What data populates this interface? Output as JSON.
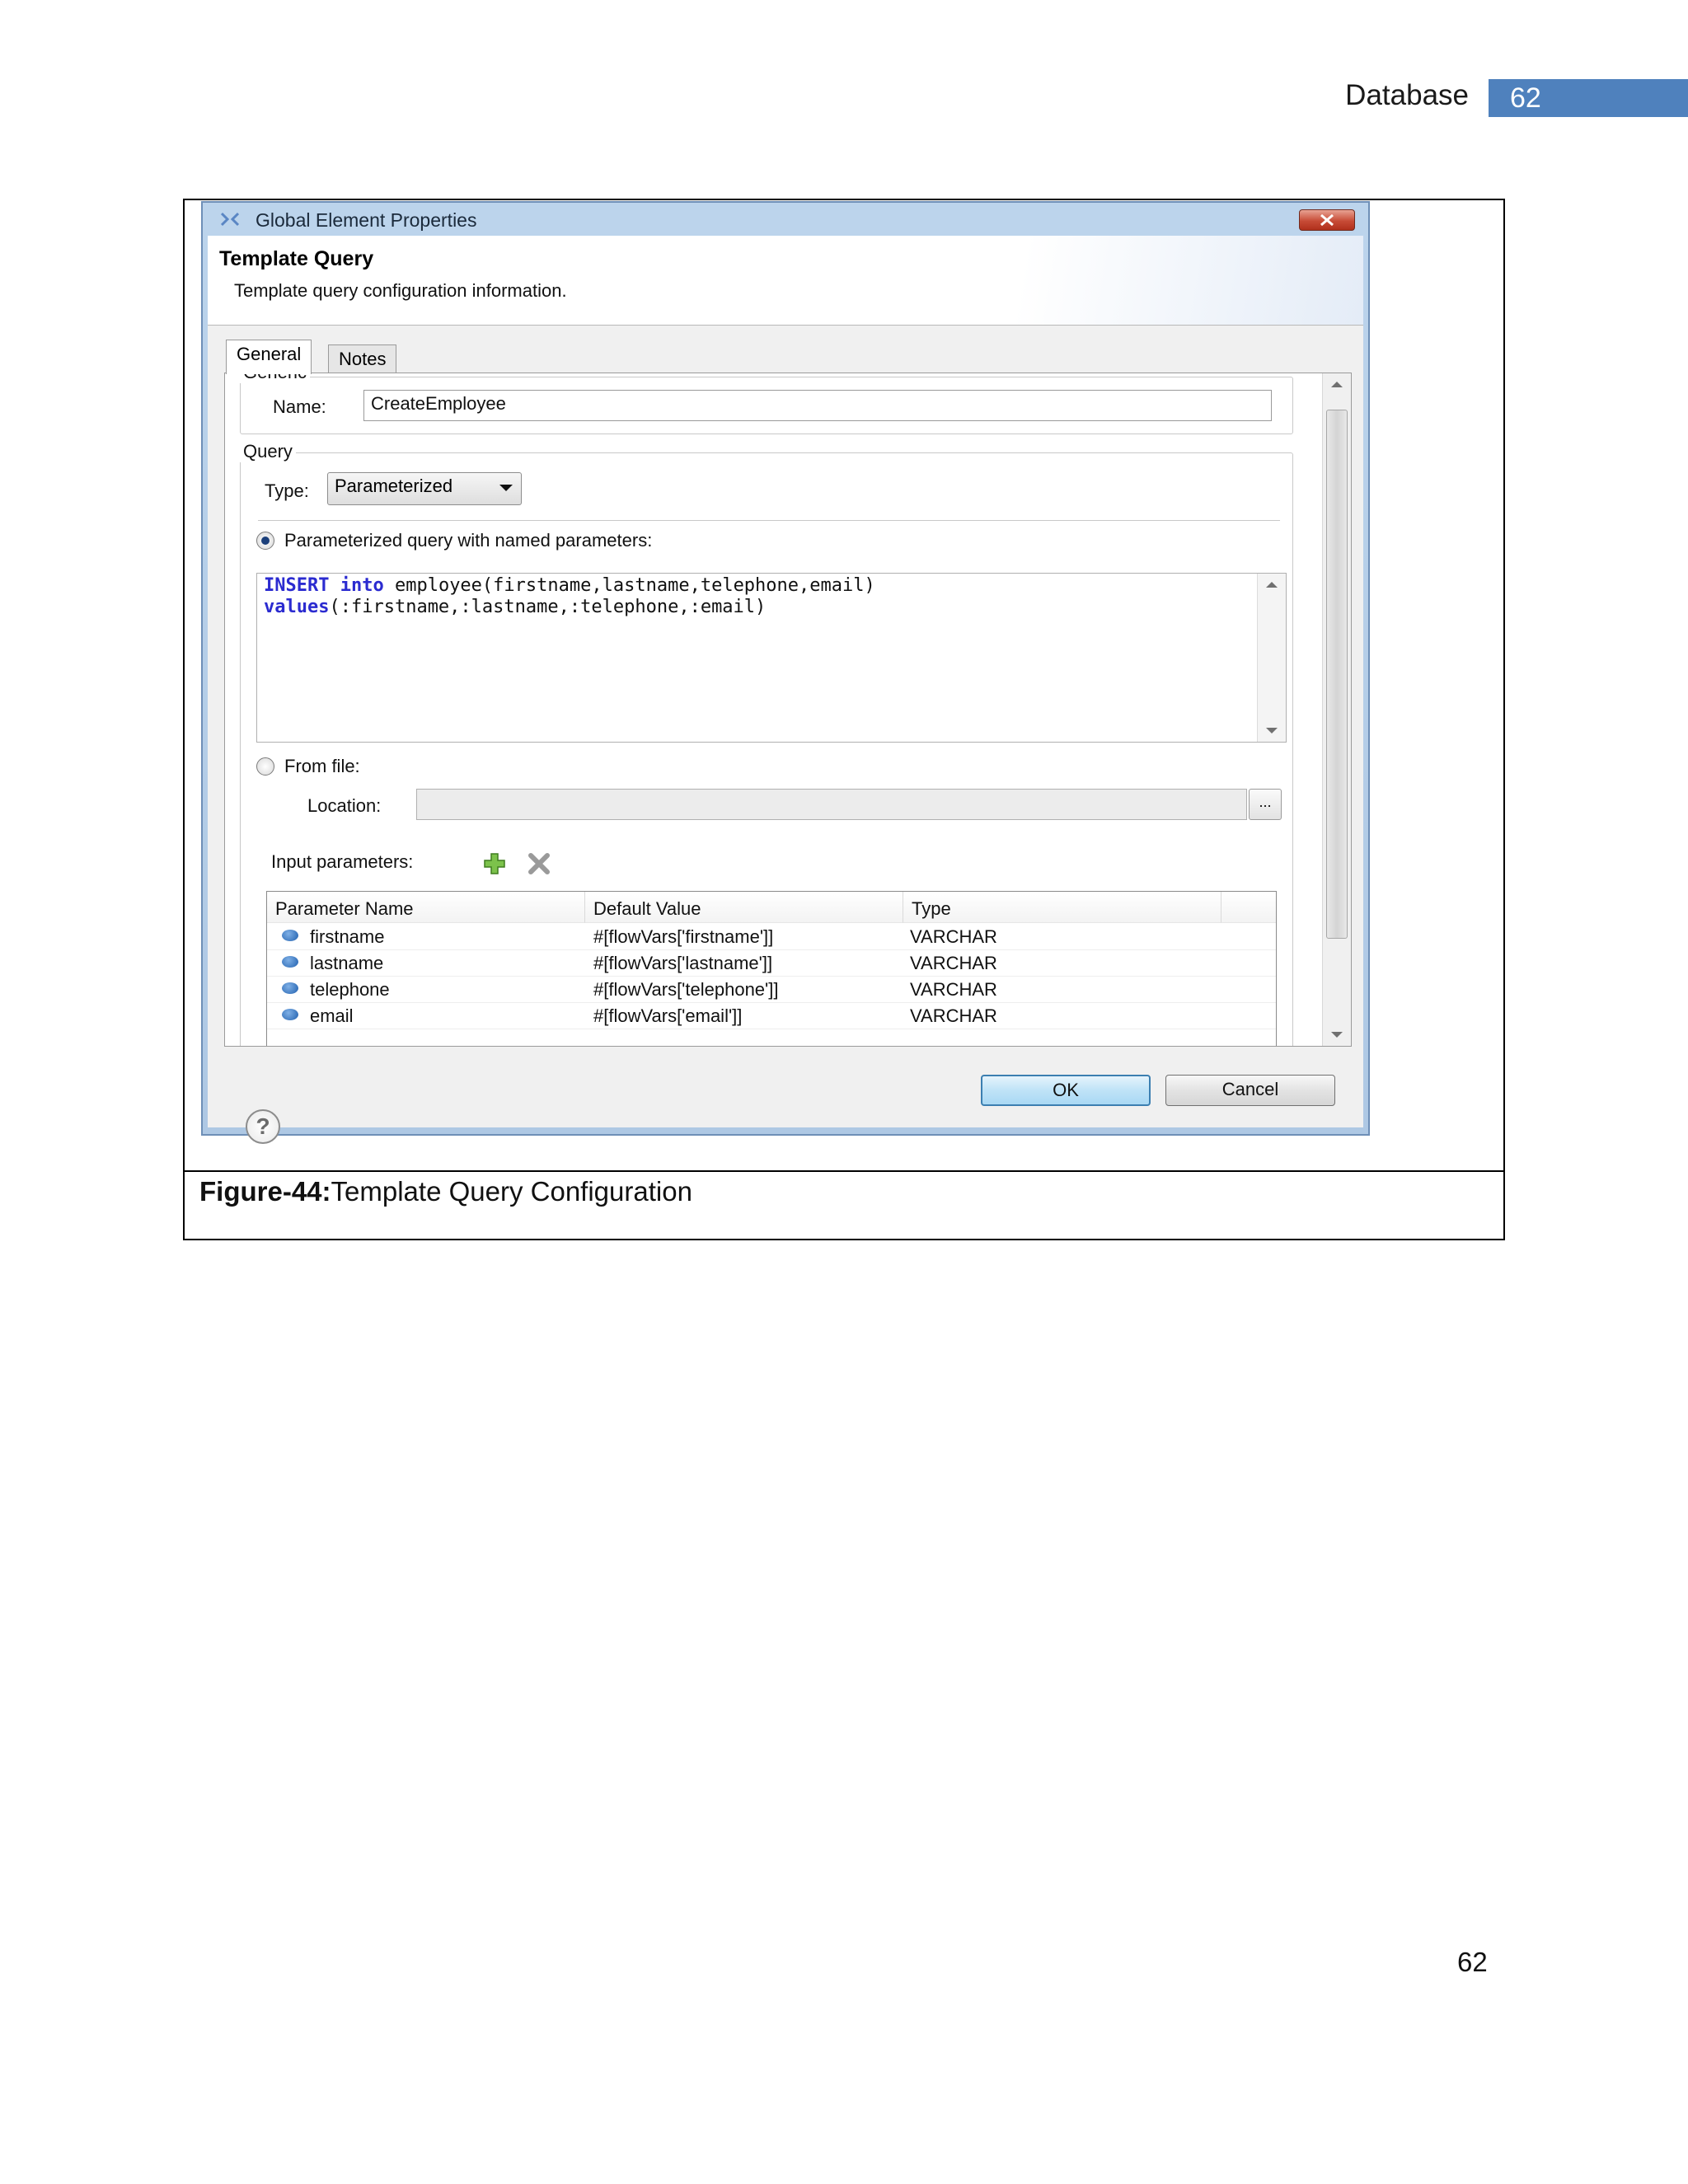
{
  "header": {
    "section": "Database",
    "page_badge": "62"
  },
  "dialog": {
    "window_title": "Global Element Properties",
    "banner_title": "Template Query",
    "banner_description": "Template query configuration information.",
    "tabs": [
      {
        "label": "General"
      },
      {
        "label": "Notes"
      }
    ],
    "generic_group": {
      "legend": "Generic",
      "name_label": "Name:",
      "name_value": "CreateEmployee"
    },
    "query_group": {
      "legend": "Query",
      "type_label": "Type:",
      "type_value": "Parameterized",
      "parameterized_radio_label": "Parameterized query with named parameters:",
      "code_line1_kw1": "INSERT",
      "code_line1_kw2": "into",
      "code_line1_rest": " employee(firstname,lastname,telephone,email)",
      "code_line2_kw": "values",
      "code_line2_rest": "(:firstname,:lastname,:telephone,:email)",
      "from_file_radio_label": "From file:",
      "location_label": "Location:",
      "browse_label": "...",
      "input_parameters_label": "Input parameters:"
    },
    "parameters_table": {
      "columns": [
        "Parameter Name",
        "Default Value",
        "Type"
      ],
      "rows": [
        {
          "name": "firstname",
          "default": "#[flowVars['firstname']]",
          "type": "VARCHAR"
        },
        {
          "name": "lastname",
          "default": "#[flowVars['lastname']]",
          "type": "VARCHAR"
        },
        {
          "name": "telephone",
          "default": "#[flowVars['telephone']]",
          "type": "VARCHAR"
        },
        {
          "name": "email",
          "default": "#[flowVars['email']]",
          "type": "VARCHAR"
        }
      ]
    },
    "buttons": {
      "help": "?",
      "ok": "OK",
      "cancel": "Cancel"
    }
  },
  "caption": {
    "label": "Figure-44:",
    "text": "Template Query Configuration"
  },
  "footer": {
    "page_number": "62"
  }
}
